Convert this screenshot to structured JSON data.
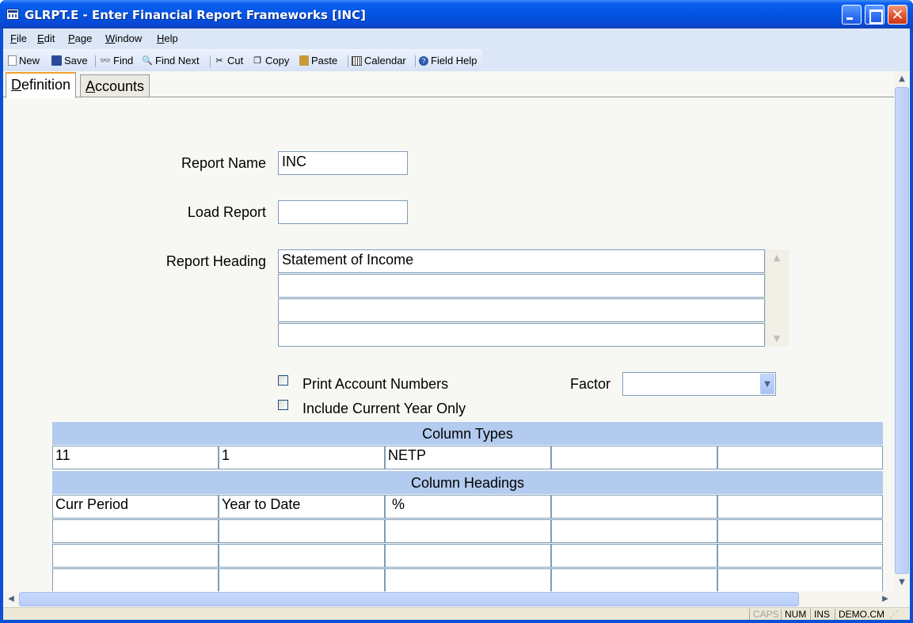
{
  "window": {
    "title": "GLRPT.E - Enter Financial Report Frameworks [INC]"
  },
  "menu": [
    {
      "label": "File",
      "accel": "F",
      "rest": "ile"
    },
    {
      "label": "Edit",
      "accel": "E",
      "rest": "dit"
    },
    {
      "label": "Page",
      "accel": "P",
      "rest": "age"
    },
    {
      "label": "Window",
      "accel": "W",
      "rest": "indow"
    },
    {
      "label": "Help",
      "accel": "H",
      "rest": "elp"
    }
  ],
  "toolbar": {
    "new": "New",
    "save": "Save",
    "find": "Find",
    "find_next": "Find Next",
    "cut": "Cut",
    "copy": "Copy",
    "paste": "Paste",
    "calendar": "Calendar",
    "field_help": "Field Help"
  },
  "tabs": {
    "definition": {
      "accel": "D",
      "rest": "efinition"
    },
    "accounts": {
      "accel": "A",
      "rest": "ccounts"
    }
  },
  "form": {
    "report_name_label": "Report Name",
    "report_name_value": "INC",
    "load_report_label": "Load Report",
    "load_report_value": "",
    "report_heading_label": "Report Heading",
    "report_heading_lines": [
      "Statement of Income",
      "",
      "",
      ""
    ],
    "print_account_numbers_label": "Print Account Numbers",
    "print_account_numbers_checked": false,
    "include_current_year_label": "Include Current Year Only",
    "include_current_year_checked": false,
    "factor_label": "Factor",
    "factor_value": ""
  },
  "grid": {
    "column_types_header": "Column Types",
    "column_types": [
      "11",
      "1",
      "NETP",
      "",
      ""
    ],
    "column_headings_header": "Column Headings",
    "column_headings": [
      [
        "Curr Period",
        "Year to Date",
        " %",
        "",
        ""
      ],
      [
        "",
        "",
        "",
        "",
        ""
      ],
      [
        "",
        "",
        "",
        "",
        ""
      ],
      [
        "",
        "",
        "",
        "",
        ""
      ]
    ]
  },
  "status": {
    "caps": "CAPS",
    "num": "NUM",
    "ins": "INS",
    "db": "DEMO.CM"
  },
  "colors": {
    "title_blue": "#0a5ff0",
    "grid_header": "#b3cbef",
    "tab_highlight": "#f0a030"
  }
}
